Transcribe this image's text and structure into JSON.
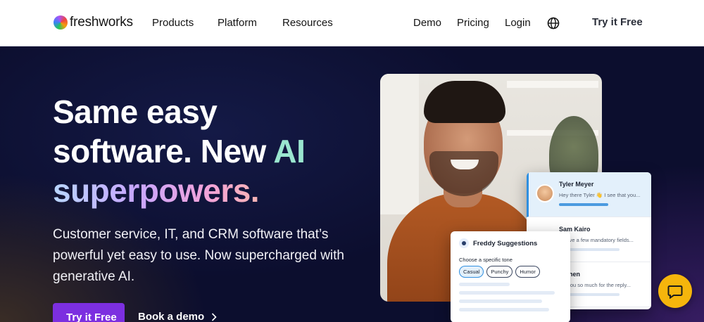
{
  "nav": {
    "logo_text": "freshworks",
    "links": [
      "Products",
      "Platform",
      "Resources"
    ],
    "right_links": [
      "Demo",
      "Pricing",
      "Login"
    ],
    "globe_icon": "globe-icon",
    "cta_label": "Try it Free"
  },
  "hero": {
    "headline_line1": "Same easy",
    "headline_line2": "software. New",
    "headline_ai": "AI",
    "headline_line3": "superpowers.",
    "subtext": "Customer service, IT, and CRM software that’s powerful yet easy to use. Now supercharged with generative AI.",
    "primary_button": "Try it Free",
    "secondary_button": "Book a demo"
  },
  "chat_list": [
    {
      "name": "Tyler Meyer",
      "message": "Hey there Tyler 👋 I see that you...",
      "active": true
    },
    {
      "name": "Sam Kairo",
      "message": "...have a few mandatory fields...",
      "active": false
    },
    {
      "name": "...Chen",
      "message": "...k you so much for the reply...",
      "active": false
    }
  ],
  "freddy": {
    "title": "Freddy Suggestions",
    "label": "Choose a specific tone",
    "chips": [
      "Casual",
      "Punchy",
      "Humor"
    ],
    "selected_chip": "Casual"
  },
  "colors": {
    "accent_purple": "#7c2fe0",
    "widget_yellow": "#f5b50c",
    "ai_green": "#9ae6cf"
  },
  "widget_icon": "chat-bubble-icon"
}
